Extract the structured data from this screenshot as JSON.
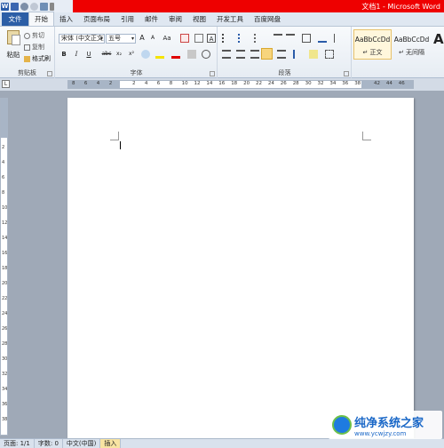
{
  "window": {
    "title": "文档1 - Microsoft Word",
    "quick_access": [
      "word-logo-icon",
      "save-icon",
      "undo-icon",
      "redo-icon",
      "print-preview-icon",
      "customize-icon"
    ]
  },
  "tabs": [
    "文件",
    "开始",
    "插入",
    "页面布局",
    "引用",
    "邮件",
    "审阅",
    "视图",
    "开发工具",
    "百度网盘"
  ],
  "active_tab": "开始",
  "ribbon": {
    "clipboard": {
      "label": "剪贴板",
      "paste": "粘贴",
      "cut": "剪切",
      "copy": "复制",
      "format_painter": "格式刷"
    },
    "font": {
      "label": "字体",
      "font_name": "宋体 (中文正文)",
      "font_size": "五号",
      "grow": "A",
      "shrink": "A",
      "case": "Aa",
      "bold": "B",
      "italic": "I",
      "underline": "U",
      "strike": "abc",
      "subscript": "x₂",
      "superscript": "x²",
      "char_border": "A"
    },
    "paragraph": {
      "label": "段落"
    },
    "styles": {
      "items": [
        {
          "sample": "AaBbCcDd",
          "name": "↵ 正文"
        },
        {
          "sample": "AaBbCcDd",
          "name": "↵ 无间隔"
        }
      ],
      "big_a": "A"
    }
  },
  "ruler": {
    "left_numbers": [
      "8",
      "6",
      "4",
      "2"
    ],
    "numbers": [
      "2",
      "4",
      "6",
      "8",
      "10",
      "12",
      "14",
      "16",
      "18",
      "20",
      "22",
      "24",
      "26",
      "28",
      "30",
      "32",
      "34",
      "36",
      "38"
    ],
    "right_numbers": [
      "42",
      "44",
      "46"
    ],
    "corner": "L"
  },
  "vruler": {
    "numbers": [
      "2",
      "4",
      "6",
      "8",
      "10",
      "12",
      "14",
      "16",
      "18",
      "20",
      "22",
      "24",
      "26",
      "28",
      "30",
      "32",
      "34",
      "36",
      "38"
    ]
  },
  "status": {
    "page": "页面: 1/1",
    "words": "字数: 0",
    "language": "中文(中国)",
    "mode": "插入"
  },
  "watermark": {
    "title": "纯净系统之家",
    "url": "www.ycwjzy.com"
  }
}
